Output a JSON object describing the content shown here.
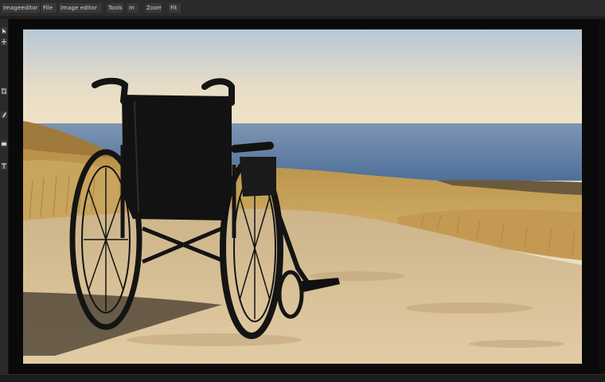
{
  "app": {
    "menu": [
      {
        "label": "Imageeditor"
      },
      {
        "label": "File"
      },
      {
        "label": "Image editor"
      },
      {
        "label": "Tools"
      },
      {
        "label": "m"
      },
      {
        "label": "Zoom"
      },
      {
        "label": "Fit"
      }
    ]
  },
  "toolbar": {
    "tools": [
      {
        "icon": "select-icon"
      },
      {
        "icon": "move-icon"
      },
      {
        "icon": "crop-icon"
      },
      {
        "icon": "brush-icon"
      },
      {
        "icon": "eraser-icon"
      },
      {
        "icon": "text-icon"
      }
    ]
  },
  "canvas": {
    "image_subject": "wheelchair-on-hillside-path",
    "colors": {
      "sky_top": "#b9c9d6",
      "sky_bottom": "#efe2c8",
      "sea": "#5f7fa6",
      "grass": "#c9a45a",
      "path": "#d9c39b",
      "wheelchair": "#141414"
    }
  }
}
